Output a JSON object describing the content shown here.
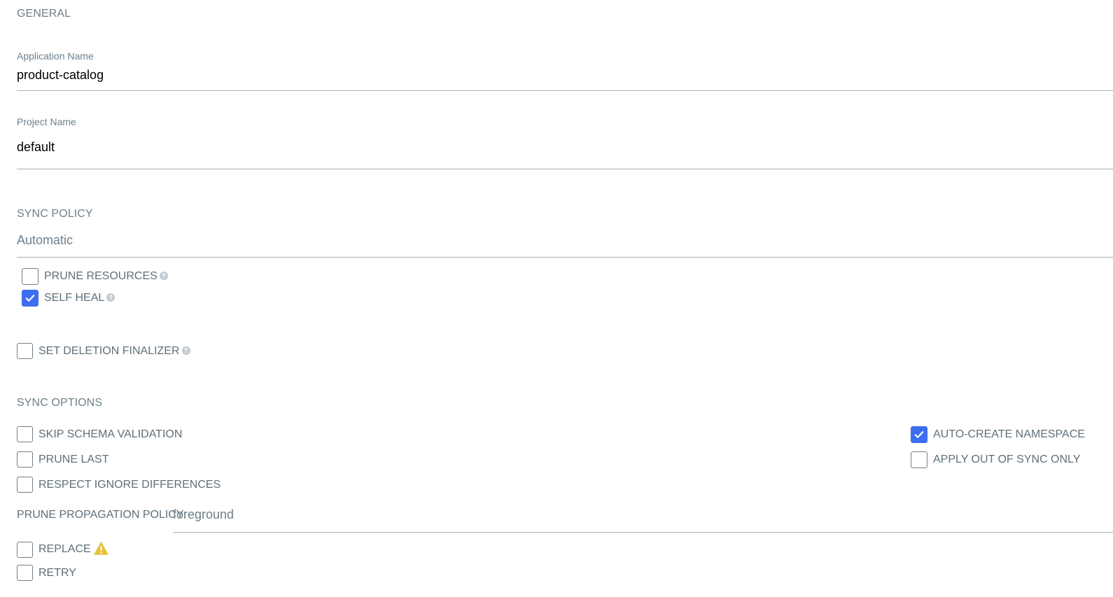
{
  "general": {
    "title": "GENERAL",
    "application_name": {
      "label": "Application Name",
      "value": "product-catalog"
    },
    "project_name": {
      "label": "Project Name",
      "value": "default"
    }
  },
  "sync_policy": {
    "title": "SYNC POLICY",
    "value": "Automatic",
    "options": [
      {
        "label": "PRUNE RESOURCES",
        "checked": false,
        "help_icon": "question-circle-icon"
      },
      {
        "label": "SELF HEAL",
        "checked": true,
        "help_icon": "question-circle-icon"
      }
    ]
  },
  "deletion_finalizer": {
    "label": "SET DELETION FINALIZER",
    "checked": false,
    "help_icon": "question-circle-icon"
  },
  "sync_options": {
    "title": "SYNC OPTIONS",
    "left": [
      {
        "label": "SKIP SCHEMA VALIDATION",
        "checked": false
      },
      {
        "label": "PRUNE LAST",
        "checked": false
      },
      {
        "label": "RESPECT IGNORE DIFFERENCES",
        "checked": false
      }
    ],
    "right": [
      {
        "label": "AUTO-CREATE NAMESPACE",
        "checked": true
      },
      {
        "label": "APPLY OUT OF SYNC ONLY",
        "checked": false
      }
    ],
    "prune_propagation": {
      "label": "PRUNE PROPAGATION POLICY:",
      "value": "foreground"
    },
    "bottom": [
      {
        "label": "REPLACE",
        "checked": false,
        "icon": "warning-icon"
      },
      {
        "label": "RETRY",
        "checked": false
      }
    ]
  },
  "colors": {
    "accent": "#3d6df0",
    "label": "#6d7f8b",
    "warning": "#e5c13b"
  }
}
